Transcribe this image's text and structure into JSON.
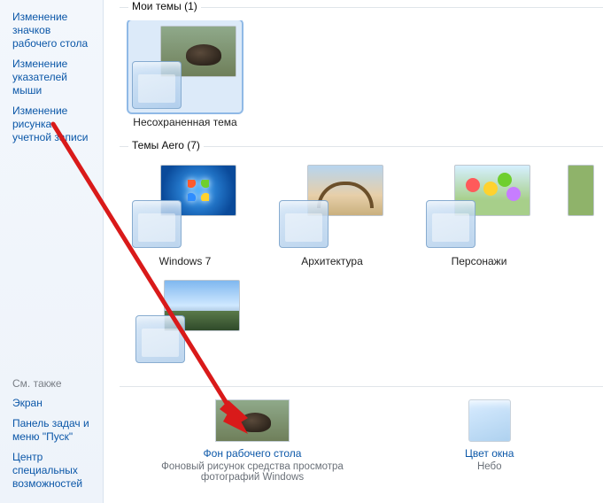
{
  "sidebar": {
    "links": [
      "Изменение значков рабочего стола",
      "Изменение указателей мыши",
      "Изменение рисунка учетной записи"
    ],
    "see_also_header": "См. также",
    "see_also": [
      "Экран",
      "Панель задач и меню \"Пуск\"",
      "Центр специальных возможностей"
    ]
  },
  "sections": {
    "my_themes": {
      "title": "Мои темы (1)",
      "items": [
        {
          "label": "Несохраненная тема"
        }
      ]
    },
    "aero": {
      "title": "Темы Aero (7)",
      "items": [
        {
          "label": "Windows 7"
        },
        {
          "label": "Архитектура"
        },
        {
          "label": "Персонажи"
        },
        {
          "label": ""
        }
      ]
    }
  },
  "bottom": {
    "wallpaper": {
      "link": "Фон рабочего стола",
      "sub": "Фоновый рисунок средства просмотра фотографий Windows"
    },
    "color": {
      "link": "Цвет окна",
      "sub": "Небо"
    }
  }
}
